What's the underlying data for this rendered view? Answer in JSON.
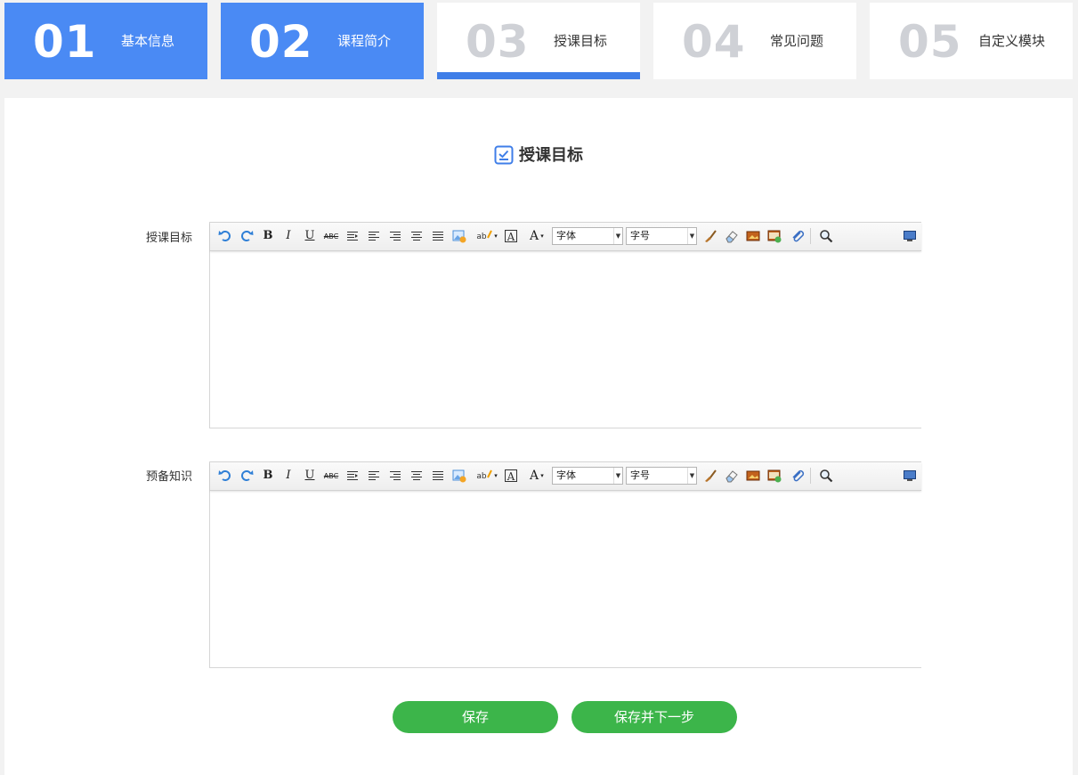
{
  "steps": [
    {
      "num": "01",
      "label": "基本信息"
    },
    {
      "num": "02",
      "label": "课程简介"
    },
    {
      "num": "03",
      "label": "授课目标"
    },
    {
      "num": "04",
      "label": "常见问题"
    },
    {
      "num": "05",
      "label": "自定义模块"
    }
  ],
  "section": {
    "title": "授课目标"
  },
  "editors": [
    {
      "label": "授课目标",
      "font_select": "字体",
      "size_select": "字号"
    },
    {
      "label": "预备知识",
      "font_select": "字体",
      "size_select": "字号"
    }
  ],
  "buttons": {
    "save": "保存",
    "save_next": "保存并下一步"
  },
  "colors": {
    "step_done": "#4a8af4",
    "active_underline": "#3f7ee8",
    "button": "#3cb54a"
  },
  "toolbar_icons": [
    "undo-icon",
    "redo-icon",
    "bold-icon",
    "italic-icon",
    "underline-icon",
    "strikethrough-icon",
    "indent-icon",
    "align-left-icon",
    "align-right-icon",
    "align-center-icon",
    "align-justify-icon",
    "insert-image-icon",
    "highlight-color-icon",
    "text-color-icon",
    "font-color-icon",
    "brush-icon",
    "eraser-icon",
    "image-icon",
    "media-icon",
    "attachment-icon",
    "search-icon",
    "preview-icon"
  ]
}
